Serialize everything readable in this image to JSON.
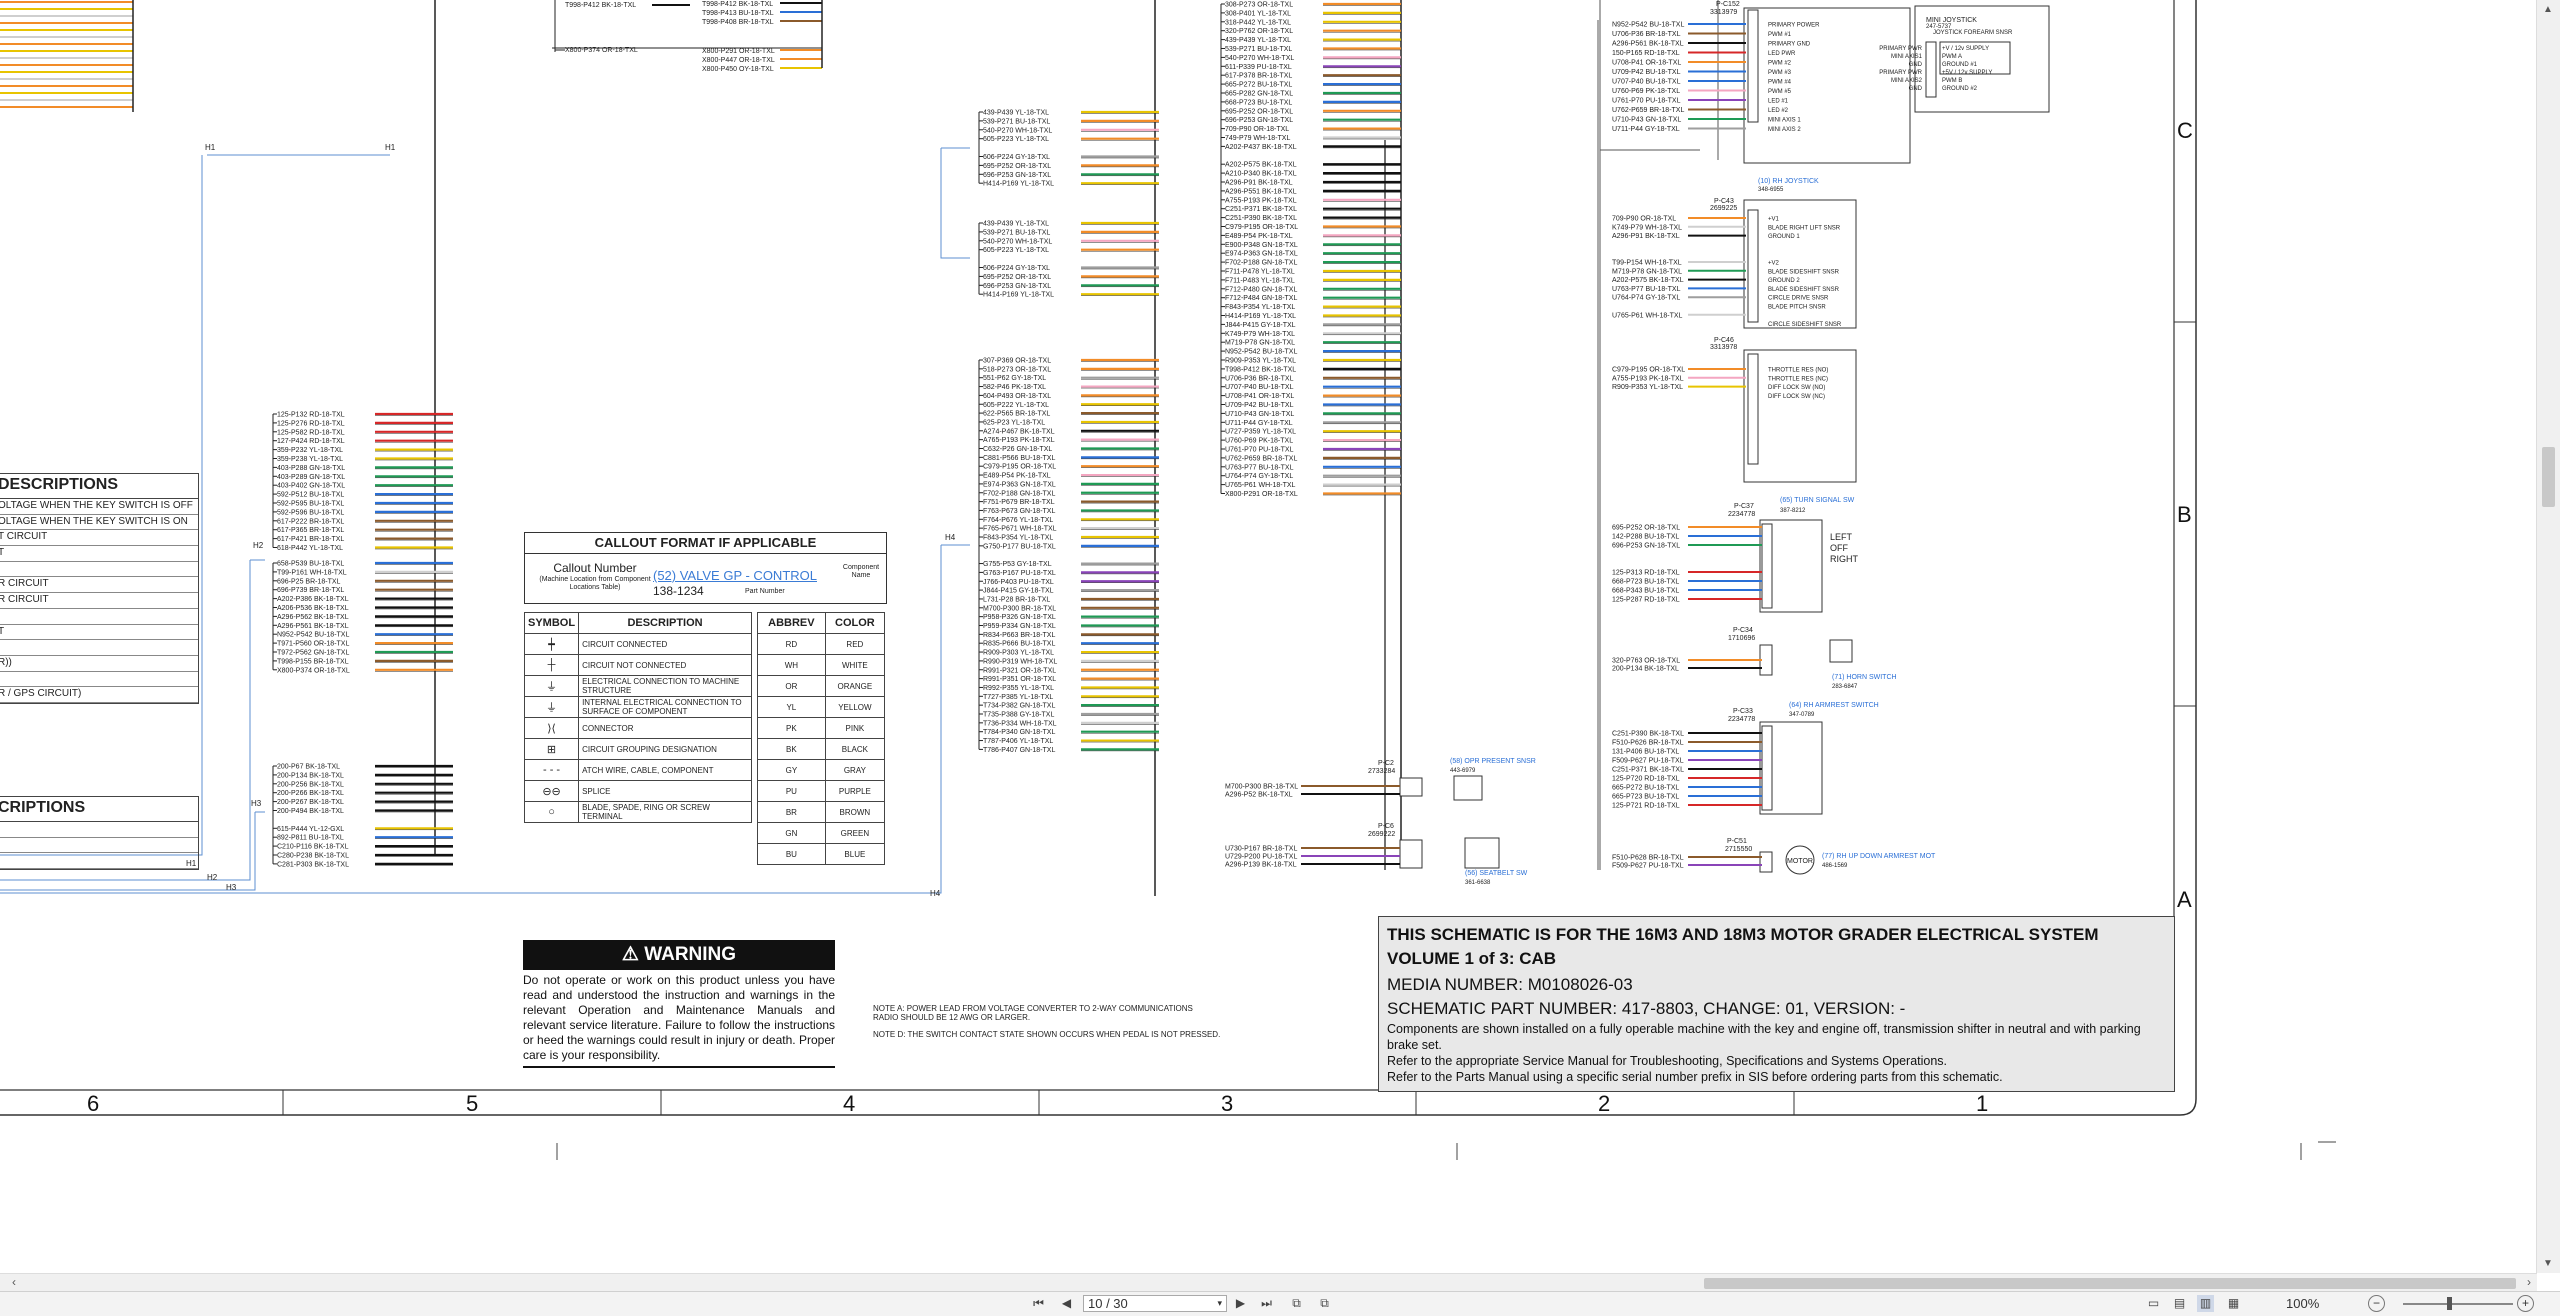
{
  "legend": {
    "title": "CALLOUT FORMAT IF APPLICABLE",
    "callout_number_label": "Callout Number",
    "callout_number_sub": "(Machine Location from Component Locations Table)",
    "example_name": "(52) VALVE GP - CONTROL",
    "example_part": "138-1234",
    "part_number_label": "Part Number",
    "component_name_label": "Component Name",
    "symbol_header": "SYMBOL",
    "description_header": "DESCRIPTION",
    "abbrev_header": "ABBREV",
    "color_header": "COLOR",
    "symbols": [
      {
        "sym": "┿",
        "desc": "CIRCUIT CONNECTED"
      },
      {
        "sym": "┼",
        "desc": "CIRCUIT NOT CONNECTED"
      },
      {
        "sym": "⏚",
        "desc": "ELECTRICAL CONNECTION TO MACHINE STRUCTURE"
      },
      {
        "sym": "⏚",
        "desc": "INTERNAL ELECTRICAL CONNECTION TO SURFACE OF COMPONENT"
      },
      {
        "sym": "⟩⟨",
        "desc": "CONNECTOR"
      },
      {
        "sym": "⊞",
        "desc": "CIRCUIT GROUPING DESIGNATION"
      },
      {
        "sym": "- - -",
        "desc": "ATCH WIRE, CABLE, COMPONENT"
      },
      {
        "sym": "⊖⊖",
        "desc": "SPLICE"
      },
      {
        "sym": "○",
        "desc": "BLADE, SPADE, RING OR SCREW TERMINAL"
      }
    ],
    "colors": [
      {
        "abbrev": "RD",
        "color": "RED"
      },
      {
        "abbrev": "WH",
        "color": "WHITE"
      },
      {
        "abbrev": "OR",
        "color": "ORANGE"
      },
      {
        "abbrev": "YL",
        "color": "YELLOW"
      },
      {
        "abbrev": "PK",
        "color": "PINK"
      },
      {
        "abbrev": "BK",
        "color": "BLACK"
      },
      {
        "abbrev": "GY",
        "color": "GRAY"
      },
      {
        "abbrev": "PU",
        "color": "PURPLE"
      },
      {
        "abbrev": "BR",
        "color": "BROWN"
      },
      {
        "abbrev": "GN",
        "color": "GREEN"
      },
      {
        "abbrev": "BU",
        "color": "BLUE"
      }
    ]
  },
  "descriptions1": {
    "title": "DESCRIPTIONS",
    "rows": [
      "OLTAGE WHEN THE KEY SWITCH IS OFF",
      "OLTAGE WHEN THE KEY SWITCH IS ON",
      "T CIRCUIT",
      "T",
      "",
      "R CIRCUIT",
      "R CIRCUIT",
      "",
      "T",
      "",
      "R))",
      "",
      "R / GPS CIRCUIT)"
    ]
  },
  "descriptions2": {
    "title": "CRIPTIONS",
    "rows": [
      "",
      "",
      ""
    ]
  },
  "warning": {
    "title": "⚠ WARNING",
    "text": "Do not operate or work on this product unless you have read and understood the instruction and warnings in the relevant Operation and Maintenance Manuals and relevant service literature. Failure to follow the instructions or heed the warnings could result in injury or death. Proper care is your responsibility."
  },
  "notes": {
    "note_a": "NOTE A: POWER LEAD FROM VOLTAGE CONVERTER TO 2-WAY COMMUNICATIONS RADIO SHOULD BE 12 AWG OR LARGER.",
    "note_d": "NOTE D: THE SWITCH CONTACT STATE SHOWN OCCURS WHEN PEDAL IS NOT PRESSED."
  },
  "titleblock": {
    "line1": "THIS SCHEMATIC IS FOR THE 16M3 AND 18M3 MOTOR GRADER ELECTRICAL SYSTEM",
    "line2": "VOLUME 1 of 3: CAB",
    "media": "MEDIA NUMBER: M0108026-03",
    "part": "SCHEMATIC PART NUMBER: 417-8803, CHANGE: 01, VERSION: -",
    "info1": "Components are shown installed on a fully operable machine with the key and engine off, transmission shifter in neutral and with parking brake set.",
    "info2": "Refer to the appropriate Service Manual for Troubleshooting, Specifications and Systems Operations.",
    "info3": "Refer to the Parts Manual using a specific serial number prefix in SIS before ordering parts from this schematic."
  },
  "zones": {
    "columns": [
      "6",
      "5",
      "4",
      "3",
      "2",
      "1"
    ],
    "rows": [
      "C",
      "B",
      "A"
    ]
  },
  "harness_labels": [
    "H1",
    "H1",
    "H2",
    "H3",
    "H4",
    "H4",
    "H1",
    "H2",
    "H3"
  ],
  "components": {
    "pc152": "P-C152",
    "pc152_part": "3313979",
    "mini_joystick": "MINI JOYSTICK",
    "mini_joystick_part": "247-5737",
    "joystick_forearm": "JOYSTICK FOREARM SNSR",
    "rh_joystick": "(10) RH JOYSTICK",
    "rh_joystick_part": "348-6955",
    "pc43": "P-C43",
    "pc43_part": "2699225",
    "pc46": "P-C46",
    "pc46_part": "3313978",
    "turn_signal": "(65) TURN SIGNAL SW",
    "turn_signal_part": "387-8212",
    "pc37": "P-C37",
    "pc37_part": "2234778",
    "turn_states": [
      "LEFT",
      "OFF",
      "RIGHT"
    ],
    "pc34": "P-C34",
    "pc34_part": "1710696",
    "horn_switch": "(71) HORN SWITCH",
    "horn_part": "283-6847",
    "rh_armrest": "(64) RH ARMREST SWITCH",
    "rh_armrest_part": "347-0789",
    "pc33": "P-C33",
    "pc33_part": "2234778",
    "pc2": "P-C2",
    "pc2_part": "2733284",
    "op_present": "(58) OPR PRESENT SNSR",
    "op_present_part": "443-6979",
    "pc6": "P-C6",
    "pc6_part": "2699222",
    "seatbelt": "(56) SEATBELT SW",
    "seatbelt_part": "361-6638",
    "pc51": "P-C51",
    "pc51_part": "2715550",
    "motor": "MOTOR",
    "armrest_motor": "(77) RH UP DOWN ARMREST MOT",
    "armrest_motor_part": "486-1569"
  },
  "pin_labels_joystick": [
    "PRIMARY POWER",
    "PWM #1",
    "PRIMARY GND",
    "LED PWR",
    "PWM #2",
    "PWM #3",
    "PWM #4",
    "PWM #5",
    "LED #1",
    "LED #2",
    "MINI AXIS 1",
    "MINI AXIS 2"
  ],
  "pin_labels_mini": [
    "+V / 12v SUPPLY",
    "PWM A",
    "GROUND #1",
    "+5V / 12v SUPPLY",
    "PWM B",
    "GROUND #2"
  ],
  "pin_labels_rh": [
    "+V1",
    "BLADE RIGHT LIFT SNSR",
    "GROUND 1",
    "",
    "",
    "+V2",
    "BLADE SIDESHIFT SNSR",
    "GROUND 2",
    "BLADE SIDESHIFT SNSR",
    "CIRCLE DRIVE SNSR",
    "BLADE PITCH SNSR",
    "",
    "CIRCLE SIDESHIFT SNSR"
  ],
  "pin_labels_pc46": [
    "THROTTLE RES (NO)",
    "THROTTLE RES (NC)",
    "DIFF LOCK SW (NO)",
    "DIFF LOCK SW (NC)"
  ],
  "wire_colors": {
    "red": "#d62728",
    "white": "#cfcfcf",
    "orange": "#f28c28",
    "yellow": "#e8c400",
    "pink": "#f4a6c1",
    "black": "#111111",
    "gray": "#9e9e9e",
    "purple": "#8a44b8",
    "brown": "#8b5a2b",
    "green": "#1f9a55",
    "blue": "#2a6fd6",
    "harness": "#5c8fd1"
  },
  "bundles": [
    {
      "labels": [
        "T998-P412 BK-18-TXL",
        "T998-P413 BU-18-TXL",
        "T998-P408 BR-18-TXL"
      ],
      "colors": [
        "black",
        "blue",
        "brown"
      ]
    },
    {
      "labels": [
        "X800-P291 OR-18-TXL",
        "X800-P447 OR-18-TXL",
        "X800-P450 OY-18-TXL"
      ],
      "colors": [
        "orange",
        "orange",
        "yellow"
      ]
    },
    {
      "labels": [
        "439-P439 YL-18-TXL",
        "539-P271 BU-18-TXL",
        "540-P270 WH-18-TXL",
        "605-P223 YL-18-TXL",
        "",
        "606-P224 GY-18-TXL",
        "695-P252 OR-18-TXL",
        "696-P253 GN-18-TXL",
        "H414-P169 YL-18-TXL"
      ],
      "colors": [
        "yellow",
        "orange",
        "pink",
        "orange",
        "",
        "gray",
        "orange",
        "green",
        "yellow"
      ]
    },
    {
      "labels": [
        "439-P439 YL-18-TXL",
        "539-P271 BU-18-TXL",
        "540-P270 WH-18-TXL",
        "605-P223 YL-18-TXL",
        "",
        "606-P224 GY-18-TXL",
        "695-P252 OR-18-TXL",
        "696-P253 GN-18-TXL",
        "H414-P169 YL-18-TXL"
      ],
      "colors": [
        "yellow",
        "orange",
        "pink",
        "orange",
        "",
        "gray",
        "orange",
        "green",
        "yellow"
      ]
    },
    {
      "labels": [
        "125-P132 RD-18-TXL",
        "125-P276 RD-18-TXL",
        "125-P582 RD-18-TXL",
        "127-P424 RD-18-TXL",
        "359-P232 YL-18-TXL",
        "359-P238 YL-18-TXL",
        "403-P288 GN-18-TXL",
        "403-P289 GN-18-TXL",
        "403-P402 GN-18-TXL",
        "592-P512 BU-18-TXL",
        "592-P595 BU-18-TXL",
        "592-P596 BU-18-TXL",
        "617-P222 BR-18-TXL",
        "617-P365 BR-18-TXL",
        "617-P421 BR-18-TXL",
        "618-P442 YL-18-TXL"
      ],
      "colors": [
        "red",
        "red",
        "red",
        "red",
        "yellow",
        "yellow",
        "green",
        "green",
        "green",
        "blue",
        "blue",
        "blue",
        "brown",
        "brown",
        "brown",
        "yellow"
      ]
    },
    {
      "labels": [
        "658-P539 BU-18-TXL",
        "T99-P161 WH-18-TXL",
        "696-P25 BR-18-TXL",
        "696-P739 BR-18-TXL",
        "A202-P386 BK-18-TXL",
        "A206-P536 BK-18-TXL",
        "A296-P562 BK-18-TXL",
        "A296-P561 BK-18-TXL",
        "N952-P542 BU-18-TXL",
        "T971-P560 OR-18-TXL",
        "T972-P562 GN-18-TXL",
        "T998-P155 BR-18-TXL",
        "X800-P374 OR-18-TXL"
      ],
      "colors": [
        "blue",
        "white",
        "brown",
        "brown",
        "black",
        "black",
        "black",
        "black",
        "blue",
        "orange",
        "green",
        "brown",
        "orange"
      ]
    },
    {
      "labels": [
        "200-P67 BK-18-TXL",
        "200-P134 BK-18-TXL",
        "200-P256 BK-18-TXL",
        "200-P266 BK-18-TXL",
        "200-P267 BK-18-TXL",
        "200-P494 BK-18-TXL",
        "",
        "615-P444 YL-12-GXL",
        "892-P811 BU-18-TXL",
        "C210-P116 BK-18-TXL",
        "C280-P238 BK-18-TXL",
        "C281-P303 BK-18-TXL"
      ],
      "colors": [
        "black",
        "black",
        "black",
        "black",
        "black",
        "black",
        "",
        "yellow",
        "blue",
        "black",
        "black",
        "black"
      ]
    },
    {
      "labels": [
        "307-P369 OR-18-TXL",
        "518-P273 OR-18-TXL",
        "551-P62 GY-18-TXL",
        "582-P46 PK-18-TXL",
        "604-P493 OR-18-TXL",
        "605-P222 YL-18-TXL",
        "622-P565 BR-18-TXL",
        "625-P23 YL-18-TXL",
        "A274-P467 BK-18-TXL",
        "A765-P193 PK-18-TXL",
        "C632-P26 GN-18-TXL",
        "C881-P566 BU-18-TXL",
        "C979-P195 OR-18-TXL",
        "E489-P54 PK-18-TXL",
        "E974-P363 GN-18-TXL",
        "F702-P188 GN-18-TXL",
        "F751-P679 BR-18-TXL",
        "F763-P673 GN-18-TXL",
        "F764-P676 YL-18-TXL",
        "F765-P671 WH-18-TXL",
        "F843-P354 YL-18-TXL",
        "G750-P177 BU-18-TXL",
        "",
        "G755-P53 GY-18-TXL",
        "G763-P167 PU-18-TXL",
        "J766-P403 PU-18-TXL",
        "J844-P415 GY-18-TXL",
        "L731-P28 BR-18-TXL",
        "M700-P300 BR-18-TXL",
        "P958-P326 GN-18-TXL",
        "P959-P334 GN-18-TXL",
        "R834-P663 BR-18-TXL",
        "R835-P666 BU-18-TXL",
        "R909-P303 YL-18-TXL",
        "R990-P319 WH-18-TXL",
        "R991-P321 OR-18-TXL",
        "R991-P351 OR-18-TXL",
        "R992-P355 YL-18-TXL",
        "T727-P385 YL-18-TXL",
        "T734-P382 GN-18-TXL",
        "T735-P388 GY-18-TXL",
        "T736-P334 WH-18-TXL",
        "T784-P340 GN-18-TXL",
        "T787-P406 YL-18-TXL",
        "T786-P407 GN-18-TXL"
      ],
      "colors": [
        "orange",
        "orange",
        "gray",
        "pink",
        "orange",
        "yellow",
        "brown",
        "yellow",
        "black",
        "pink",
        "green",
        "blue",
        "orange",
        "pink",
        "green",
        "green",
        "brown",
        "green",
        "yellow",
        "white",
        "yellow",
        "blue",
        "",
        "gray",
        "purple",
        "purple",
        "gray",
        "brown",
        "brown",
        "green",
        "green",
        "brown",
        "blue",
        "yellow",
        "white",
        "orange",
        "orange",
        "yellow",
        "yellow",
        "green",
        "gray",
        "white",
        "green",
        "yellow",
        "green"
      ]
    },
    {
      "labels": [
        "308-P273 OR-18-TXL",
        "308-P401 YL-18-TXL",
        "318-P442 YL-18-TXL",
        "320-P762 OR-18-TXL",
        "439-P439 YL-18-TXL",
        "539-P271 BU-18-TXL",
        "540-P270 WH-18-TXL",
        "611-P339 PU-18-TXL",
        "617-P378 BR-18-TXL",
        "665-P272 BU-18-TXL",
        "665-P282 GN-18-TXL",
        "668-P723 BU-18-TXL",
        "695-P252 OR-18-TXL",
        "696-P253 GN-18-TXL",
        "709-P90 OR-18-TXL",
        "749-P79 WH-18-TXL",
        "A202-P437 BK-18-TXL",
        "",
        "A202-P575 BK-18-TXL",
        "A210-P340 BK-18-TXL",
        "A296-P91 BK-18-TXL",
        "A296-P551 BK-18-TXL",
        "A755-P193 PK-18-TXL",
        "C251-P371 BK-18-TXL",
        "C251-P390 BK-18-TXL",
        "C979-P195 OR-18-TXL",
        "E489-P54 PK-18-TXL",
        "E900-P348 GN-18-TXL",
        "E974-P363 GN-18-TXL",
        "F702-P188 GN-18-TXL",
        "F711-P478 YL-18-TXL",
        "F711-P483 YL-18-TXL",
        "F712-P480 GN-18-TXL",
        "F712-P484 GN-18-TXL",
        "F843-P354 YL-18-TXL",
        "H414-P169 YL-18-TXL",
        "J844-P415 GY-18-TXL",
        "K749-P79 WH-18-TXL",
        "M719-P78 GN-18-TXL",
        "N952-P542 BU-18-TXL",
        "R909-P353 YL-18-TXL",
        "T998-P412 BK-18-TXL",
        "U706-P36 BR-18-TXL",
        "U707-P40 BU-18-TXL",
        "U708-P41 OR-18-TXL",
        "U709-P42 BU-18-TXL",
        "U710-P43 GN-18-TXL",
        "U711-P44 GY-18-TXL",
        "U727-P359 YL-18-TXL",
        "U760-P69 PK-18-TXL",
        "U761-P70 PU-18-TXL",
        "U762-P659 BR-18-TXL",
        "U763-P77 BU-18-TXL",
        "U764-P74 GY-18-TXL",
        "U765-P61 WH-18-TXL",
        "X800-P291 OR-18-TXL"
      ],
      "colors": [
        "orange",
        "yellow",
        "yellow",
        "orange",
        "yellow",
        "orange",
        "pink",
        "purple",
        "brown",
        "blue",
        "green",
        "blue",
        "orange",
        "green",
        "orange",
        "white",
        "black",
        "",
        "black",
        "black",
        "black",
        "black",
        "pink",
        "black",
        "black",
        "orange",
        "pink",
        "green",
        "green",
        "green",
        "yellow",
        "yellow",
        "green",
        "green",
        "yellow",
        "yellow",
        "gray",
        "white",
        "green",
        "blue",
        "yellow",
        "black",
        "brown",
        "blue",
        "orange",
        "blue",
        "green",
        "gray",
        "yellow",
        "pink",
        "purple",
        "brown",
        "blue",
        "gray",
        "white",
        "orange"
      ]
    }
  ],
  "right_wires": {
    "joystick": [
      "N952-P542 BU-18-TXL",
      "U706-P36 BR-18-TXL",
      "A296-P561 BK-18-TXL",
      "150-P165 RD-18-TXL",
      "U708-P41 OR-18-TXL",
      "U709-P42 BU-18-TXL",
      "U707-P40 BU-18-TXL",
      "U760-P69 PK-18-TXL",
      "U761-P70 PU-18-TXL",
      "U762-P659 BR-18-TXL",
      "U710-P43 GN-18-TXL",
      "U711-P44 GY-18-TXL"
    ],
    "joystick_colors": [
      "blue",
      "brown",
      "black",
      "red",
      "orange",
      "blue",
      "blue",
      "pink",
      "purple",
      "brown",
      "green",
      "gray"
    ],
    "rh": [
      "709-P90 OR-18-TXL",
      "K749-P79 WH-18-TXL",
      "A296-P91 BK-18-TXL",
      "",
      "",
      "T99-P154 WH-18-TXL",
      "M719-P78 GN-18-TXL",
      "A202-P575 BK-18-TXL",
      "U763-P77 BU-18-TXL",
      "U764-P74 GY-18-TXL",
      "",
      "U765-P61 WH-18-TXL"
    ],
    "rh_colors": [
      "orange",
      "white",
      "black",
      "",
      "",
      "white",
      "green",
      "black",
      "blue",
      "gray",
      "",
      "white"
    ],
    "pc46": [
      "C979-P195 OR-18-TXL",
      "A755-P193 PK-18-TXL",
      "R909-P353 YL-18-TXL"
    ],
    "pc46_colors": [
      "orange",
      "pink",
      "yellow"
    ],
    "turn": [
      "695-P252 OR-18-TXL",
      "142-P288 BU-18-TXL",
      "696-P253 GN-18-TXL",
      "",
      "",
      "125-P313 RD-18-TXL",
      "668-P723 BU-18-TXL",
      "668-P343 BU-18-TXL",
      "125-P287 RD-18-TXL"
    ],
    "turn_colors": [
      "orange",
      "blue",
      "green",
      "",
      "",
      "red",
      "blue",
      "blue",
      "red"
    ],
    "horn": [
      "320-P763 OR-18-TXL",
      "200-P134 BK-18-TXL"
    ],
    "horn_colors": [
      "orange",
      "black"
    ],
    "armrest": [
      "C251-P390 BK-18-TXL",
      "F510-P626 BR-18-TXL",
      "131-P406 BU-18-TXL",
      "F509-P627 PU-18-TXL",
      "C251-P371 BK-18-TXL",
      "125-P720 RD-18-TXL",
      "665-P272 BU-18-TXL",
      "665-P723 BU-18-TXL",
      "125-P721 RD-18-TXL"
    ],
    "armrest_colors": [
      "black",
      "brown",
      "blue",
      "purple",
      "black",
      "red",
      "blue",
      "blue",
      "red"
    ],
    "opr": [
      "M700-P300 BR-18-TXL",
      "A296-P52 BK-18-TXL"
    ],
    "opr_colors": [
      "brown",
      "black"
    ],
    "seat": [
      "U730-P167 BR-18-TXL",
      "U729-P200 PU-18-TXL",
      "A296-P139 BK-18-TXL"
    ],
    "seat_colors": [
      "brown",
      "purple",
      "black"
    ],
    "motor": [
      "F510-P628 BR-18-TXL",
      "F509-P627 PU-18-TXL"
    ],
    "motor_colors": [
      "brown",
      "purple"
    ]
  },
  "top_left_bundle": {
    "label": "T998-P155 BR-18-TXL",
    "label2": "X800-P374 OR-18-TXL"
  },
  "toolbar": {
    "page_value": "10 / 30",
    "zoom": "100%"
  }
}
